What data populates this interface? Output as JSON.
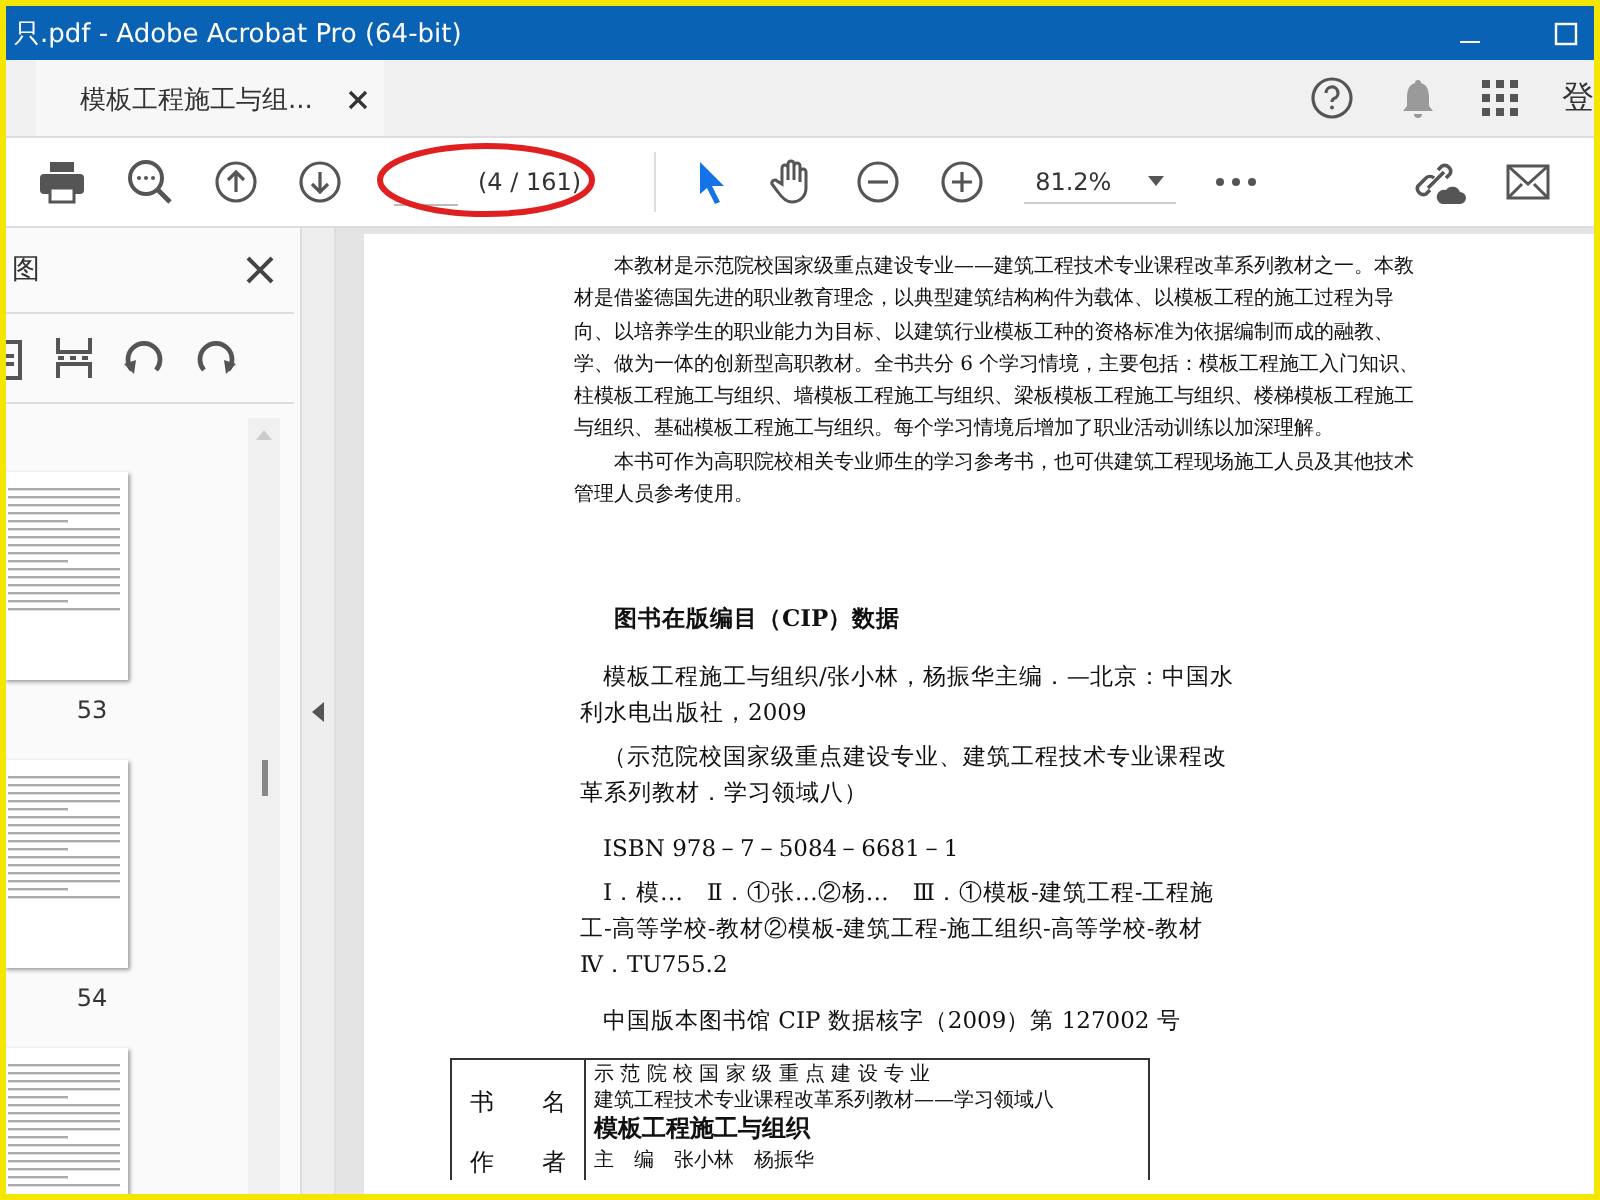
{
  "window": {
    "title": "只.pdf - Adobe Acrobat Pro (64-bit)"
  },
  "tabs": [
    {
      "label": "模板工程施工与组...",
      "selected": true
    }
  ],
  "account": {
    "label": "登"
  },
  "toolbar": {
    "page_count": "(4 / 161)",
    "zoom": "81.2%"
  },
  "sidebar": {
    "title": "图",
    "thumbnails": [
      {
        "label": "53"
      },
      {
        "label": "54"
      }
    ]
  },
  "document": {
    "paragraphs": [
      "本教材是示范院校国家级重点建设专业——建筑工程技术专业课程改革系列教材之一。本教材是借鉴德国先进的职业教育理念，以典型建筑结构构件为载体、以模板工程的施工过程为导向、以培养学生的职业能力为目标、以建筑行业模板工种的资格标准为依据编制而成的融教、学、做为一体的创新型高职教材。全书共分 6 个学习情境，主要包括：模板工程施工入门知识、柱模板工程施工与组织、墙模板工程施工与组织、梁板模板工程施工与组织、楼梯模板工程施工与组织、基础模板工程施工与组织。每个学习情境后增加了职业活动训练以加深理解。",
      "本书可作为高职院校相关专业师生的学习参考书，也可供建筑工程现场施工人员及其他技术管理人员参考使用。"
    ],
    "cip_title": "图书在版编目（CIP）数据",
    "cip_entries": [
      "模板工程施工与组织/张小林，杨振华主编．—北京：中国水利水电出版社，2009",
      "（示范院校国家级重点建设专业、建筑工程技术专业课程改革系列教材．学习领域八）",
      "ISBN 978－7－5084－6681－1",
      "Ⅰ．模…　Ⅱ．①张…②杨…　Ⅲ．①模板-建筑工程-工程施工-高等学校-教材②模板-建筑工程-施工组织-高等学校-教材　Ⅳ．TU755.2",
      "中国版本图书馆 CIP 数据核字（2009）第 127002 号"
    ],
    "table": [
      {
        "label": "书　　名",
        "lines": [
          "示 范 院 校 国 家 级 重 点 建 设 专 业",
          "建筑工程技术专业课程改革系列教材——学习领域八",
          "模板工程施工与组织"
        ]
      },
      {
        "label": "作　　者",
        "lines": [
          "主　编　张小林　杨振华"
        ]
      }
    ]
  }
}
